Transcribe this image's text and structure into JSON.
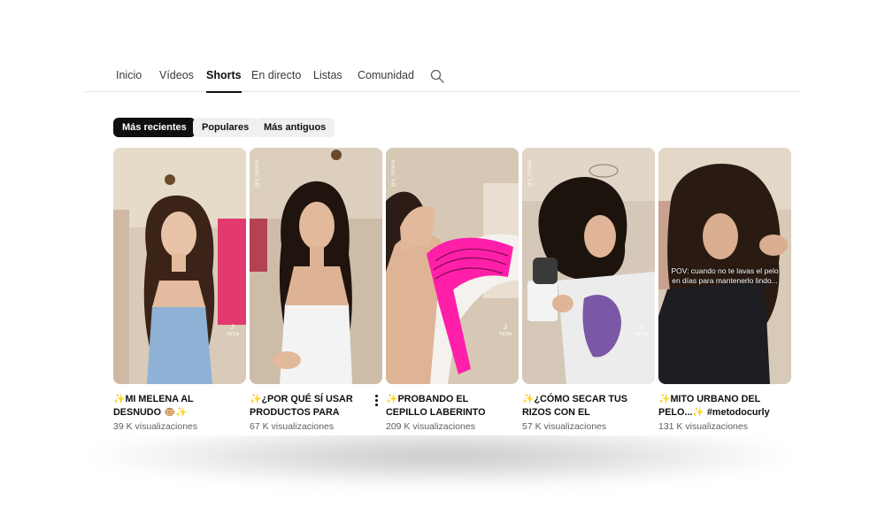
{
  "nav": {
    "tabs": [
      {
        "label": "Inicio"
      },
      {
        "label": "Vídeos"
      },
      {
        "label": "Shorts"
      },
      {
        "label": "En directo"
      },
      {
        "label": "Listas"
      },
      {
        "label": "Comunidad"
      }
    ],
    "active_tab": "Shorts",
    "search_icon": "search-icon"
  },
  "filters": {
    "chips": [
      {
        "label": "Más recientes"
      },
      {
        "label": "Populares"
      },
      {
        "label": "Más antiguos"
      }
    ],
    "active_chip": "Más recientes"
  },
  "shorts": [
    {
      "title": "✨MI MELENA AL DESNUDO 🐵✨ #metodocurly",
      "views": "39 K visualizaciones",
      "watermark": "TikTok"
    },
    {
      "title": "✨¿POR QUÉ SÍ USAR PRODUCTOS PARA RIZOS?...",
      "views": "67 K visualizaciones",
      "handle": "@a_lumina"
    },
    {
      "title": "✨PROBANDO EL CEPILLO LABERINTO ✨...",
      "views": "209 K visualizaciones",
      "handle": "@a_lumina",
      "watermark": "TikTok"
    },
    {
      "title": "✨¿CÓMO SECAR TUS RIZOS CON EL DIFUSOR?...",
      "views": "57 K visualizaciones",
      "handle": "@a_lumina",
      "watermark": "TikTok"
    },
    {
      "title": "✨MITO URBANO DEL PELO...✨ #metodocurly",
      "views": "131 K visualizaciones",
      "overlay_text": "POV: cuando no te lavas el pelo en días para mantenerlo lindo..."
    }
  ],
  "colors": {
    "active_chip_bg": "#0f0f0f",
    "chip_bg": "#f0f0f0",
    "brush_pink": "#ff1fa8"
  }
}
